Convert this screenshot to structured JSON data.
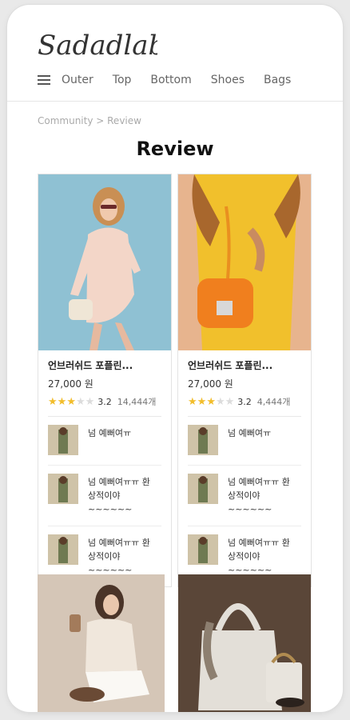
{
  "brand": {
    "logo_text": "Sadadlab"
  },
  "nav": {
    "items": [
      "Outer",
      "Top",
      "Bottom",
      "Shoes",
      "Bags"
    ]
  },
  "breadcrumb": "Community > Review",
  "page_title": "Review",
  "cards": [
    {
      "product_name": "언브러쉬드 포플린...",
      "price": "27,000 원",
      "rating": "3.2",
      "review_count": "14,444개",
      "reviews": [
        "넘 예뻐여ㅠ",
        "넘 예뻐여ㅠㅠ 환\n상적이야~~~~~~",
        "넘 예뻐여ㅠㅠ 환\n상적이야~~~~~~"
      ]
    },
    {
      "product_name": "언브러쉬드 포플린...",
      "price": "27,000 원",
      "rating": "3.2",
      "review_count": "4,444개",
      "reviews": [
        "넘 예뻐여ㅠ",
        "넘 예뻐여ㅠㅠ 환\n상적이야~~~~~~",
        "넘 예뻐여ㅠㅠ 환\n상적이야~~~~~~"
      ]
    }
  ],
  "rating_stars_filled": 3,
  "rating_stars_total": 5,
  "colors": {
    "star": "#f2bd2b",
    "photo1_bg": "#8fc1d3",
    "photo2_bg": "#e7b48e"
  }
}
